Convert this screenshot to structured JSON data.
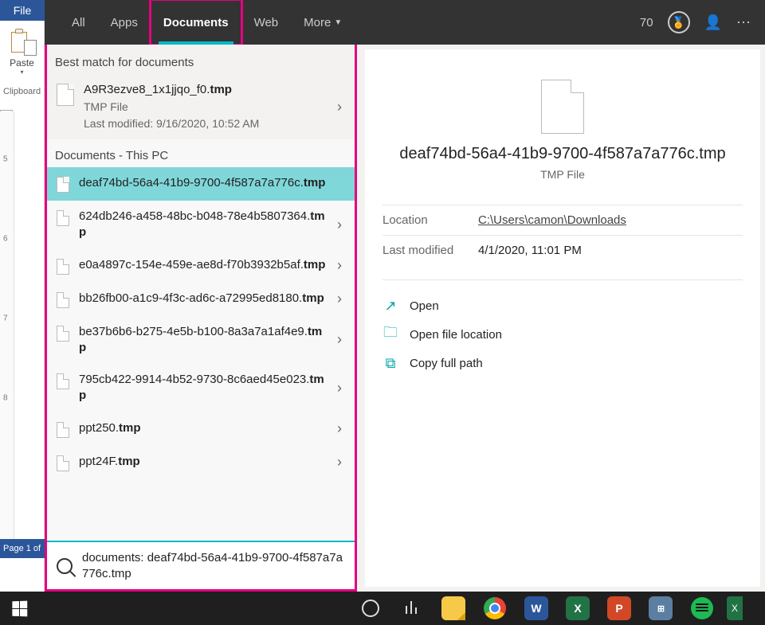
{
  "ribbon": {
    "file_label": "File",
    "paste_label": "Paste",
    "clipboard_label": "Clipboard",
    "status": "Page 1 of"
  },
  "tabs": {
    "all": "All",
    "apps": "Apps",
    "documents": "Documents",
    "web": "Web",
    "more": "More"
  },
  "header": {
    "points": "70"
  },
  "labels": {
    "best_match": "Best match for documents",
    "documents_pc": "Documents - This PC"
  },
  "best_match": {
    "name_pre": "A9R3ezve8_1x1jjqo_f0.",
    "name_bold": "tmp",
    "type": "TMP File",
    "modified": "Last modified: 9/16/2020, 10:52 AM"
  },
  "results": [
    {
      "pre": "deaf74bd-56a4-41b9-9700-4f587a7a776c.",
      "bold": "tmp",
      "selected": true,
      "chev": false
    },
    {
      "pre": "624db246-a458-48bc-b048-78e4b5807364.",
      "bold": "tmp",
      "selected": false,
      "chev": true
    },
    {
      "pre": "e0a4897c-154e-459e-ae8d-f70b3932b5af.",
      "bold": "tmp",
      "selected": false,
      "chev": true
    },
    {
      "pre": "bb26fb00-a1c9-4f3c-ad6c-a72995ed8180.",
      "bold": "tmp",
      "selected": false,
      "chev": true
    },
    {
      "pre": "be37b6b6-b275-4e5b-b100-8a3a7a1af4e9.",
      "bold": "tmp",
      "selected": false,
      "chev": true
    },
    {
      "pre": "795cb422-9914-4b52-9730-8c6aed45e023.",
      "bold": "tmp",
      "selected": false,
      "chev": true
    },
    {
      "pre": "ppt250.",
      "bold": "tmp",
      "selected": false,
      "chev": true
    },
    {
      "pre": "ppt24F.",
      "bold": "tmp",
      "selected": false,
      "chev": true
    }
  ],
  "search": {
    "query": "documents: deaf74bd-56a4-41b9-9700-4f587a7a776c.tmp"
  },
  "preview": {
    "title": "deaf74bd-56a4-41b9-9700-4f587a7a776c.tmp",
    "type": "TMP File",
    "location_label": "Location",
    "location": "C:\\Users\\camon\\Downloads",
    "modified_label": "Last modified",
    "modified": "4/1/2020, 11:01 PM",
    "actions": {
      "open": "Open",
      "open_location": "Open file location",
      "copy_path": "Copy full path"
    }
  }
}
